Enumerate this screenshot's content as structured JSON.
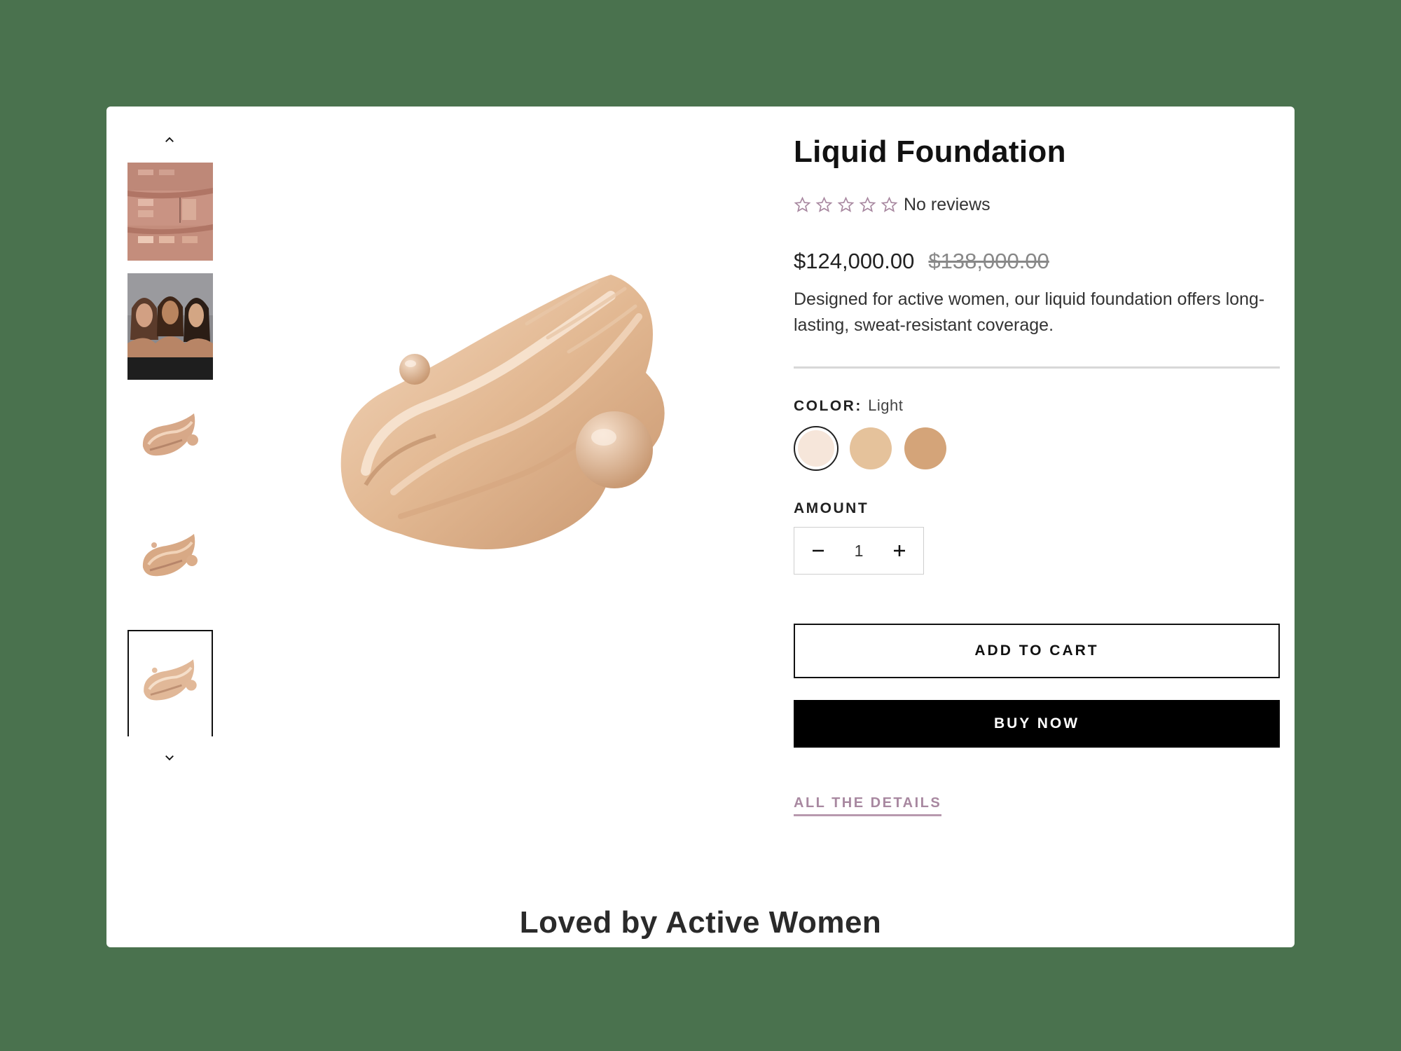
{
  "product": {
    "title": "Liquid Foundation",
    "reviews_text": "No reviews",
    "rating_stars": 0,
    "price": "$124,000.00",
    "compare_price": "$138,000.00",
    "description": "Designed for active women, our liquid foundation offers long-lasting, sweat-resistant coverage."
  },
  "color": {
    "label": "COLOR:",
    "selected": "Light",
    "swatches": [
      "#f6e6da",
      "#e5c29b",
      "#d4a479"
    ]
  },
  "amount": {
    "label": "AMOUNT",
    "value": "1"
  },
  "buttons": {
    "add_to_cart": "ADD TO CART",
    "buy_now": "BUY NOW"
  },
  "details_link": "ALL THE DETAILS",
  "section_heading": "Loved by Active Women",
  "colors": {
    "background": "#4a724e",
    "star_outline": "#a888a0",
    "link": "#a888a0"
  }
}
